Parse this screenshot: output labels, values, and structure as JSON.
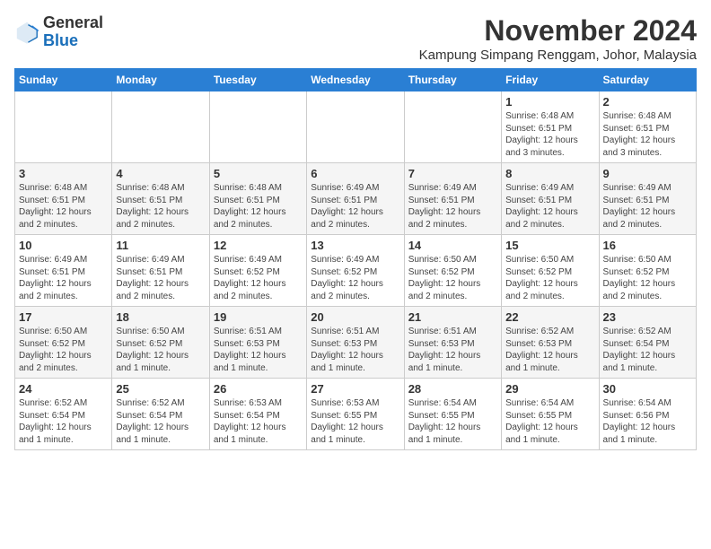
{
  "header": {
    "logo_general": "General",
    "logo_blue": "Blue",
    "month_title": "November 2024",
    "location": "Kampung Simpang Renggam, Johor, Malaysia"
  },
  "weekdays": [
    "Sunday",
    "Monday",
    "Tuesday",
    "Wednesday",
    "Thursday",
    "Friday",
    "Saturday"
  ],
  "weeks": [
    [
      {
        "day": "",
        "info": ""
      },
      {
        "day": "",
        "info": ""
      },
      {
        "day": "",
        "info": ""
      },
      {
        "day": "",
        "info": ""
      },
      {
        "day": "",
        "info": ""
      },
      {
        "day": "1",
        "info": "Sunrise: 6:48 AM\nSunset: 6:51 PM\nDaylight: 12 hours\nand 3 minutes."
      },
      {
        "day": "2",
        "info": "Sunrise: 6:48 AM\nSunset: 6:51 PM\nDaylight: 12 hours\nand 3 minutes."
      }
    ],
    [
      {
        "day": "3",
        "info": "Sunrise: 6:48 AM\nSunset: 6:51 PM\nDaylight: 12 hours\nand 2 minutes."
      },
      {
        "day": "4",
        "info": "Sunrise: 6:48 AM\nSunset: 6:51 PM\nDaylight: 12 hours\nand 2 minutes."
      },
      {
        "day": "5",
        "info": "Sunrise: 6:48 AM\nSunset: 6:51 PM\nDaylight: 12 hours\nand 2 minutes."
      },
      {
        "day": "6",
        "info": "Sunrise: 6:49 AM\nSunset: 6:51 PM\nDaylight: 12 hours\nand 2 minutes."
      },
      {
        "day": "7",
        "info": "Sunrise: 6:49 AM\nSunset: 6:51 PM\nDaylight: 12 hours\nand 2 minutes."
      },
      {
        "day": "8",
        "info": "Sunrise: 6:49 AM\nSunset: 6:51 PM\nDaylight: 12 hours\nand 2 minutes."
      },
      {
        "day": "9",
        "info": "Sunrise: 6:49 AM\nSunset: 6:51 PM\nDaylight: 12 hours\nand 2 minutes."
      }
    ],
    [
      {
        "day": "10",
        "info": "Sunrise: 6:49 AM\nSunset: 6:51 PM\nDaylight: 12 hours\nand 2 minutes."
      },
      {
        "day": "11",
        "info": "Sunrise: 6:49 AM\nSunset: 6:51 PM\nDaylight: 12 hours\nand 2 minutes."
      },
      {
        "day": "12",
        "info": "Sunrise: 6:49 AM\nSunset: 6:52 PM\nDaylight: 12 hours\nand 2 minutes."
      },
      {
        "day": "13",
        "info": "Sunrise: 6:49 AM\nSunset: 6:52 PM\nDaylight: 12 hours\nand 2 minutes."
      },
      {
        "day": "14",
        "info": "Sunrise: 6:50 AM\nSunset: 6:52 PM\nDaylight: 12 hours\nand 2 minutes."
      },
      {
        "day": "15",
        "info": "Sunrise: 6:50 AM\nSunset: 6:52 PM\nDaylight: 12 hours\nand 2 minutes."
      },
      {
        "day": "16",
        "info": "Sunrise: 6:50 AM\nSunset: 6:52 PM\nDaylight: 12 hours\nand 2 minutes."
      }
    ],
    [
      {
        "day": "17",
        "info": "Sunrise: 6:50 AM\nSunset: 6:52 PM\nDaylight: 12 hours\nand 2 minutes."
      },
      {
        "day": "18",
        "info": "Sunrise: 6:50 AM\nSunset: 6:52 PM\nDaylight: 12 hours\nand 1 minute."
      },
      {
        "day": "19",
        "info": "Sunrise: 6:51 AM\nSunset: 6:53 PM\nDaylight: 12 hours\nand 1 minute."
      },
      {
        "day": "20",
        "info": "Sunrise: 6:51 AM\nSunset: 6:53 PM\nDaylight: 12 hours\nand 1 minute."
      },
      {
        "day": "21",
        "info": "Sunrise: 6:51 AM\nSunset: 6:53 PM\nDaylight: 12 hours\nand 1 minute."
      },
      {
        "day": "22",
        "info": "Sunrise: 6:52 AM\nSunset: 6:53 PM\nDaylight: 12 hours\nand 1 minute."
      },
      {
        "day": "23",
        "info": "Sunrise: 6:52 AM\nSunset: 6:54 PM\nDaylight: 12 hours\nand 1 minute."
      }
    ],
    [
      {
        "day": "24",
        "info": "Sunrise: 6:52 AM\nSunset: 6:54 PM\nDaylight: 12 hours\nand 1 minute."
      },
      {
        "day": "25",
        "info": "Sunrise: 6:52 AM\nSunset: 6:54 PM\nDaylight: 12 hours\nand 1 minute."
      },
      {
        "day": "26",
        "info": "Sunrise: 6:53 AM\nSunset: 6:54 PM\nDaylight: 12 hours\nand 1 minute."
      },
      {
        "day": "27",
        "info": "Sunrise: 6:53 AM\nSunset: 6:55 PM\nDaylight: 12 hours\nand 1 minute."
      },
      {
        "day": "28",
        "info": "Sunrise: 6:54 AM\nSunset: 6:55 PM\nDaylight: 12 hours\nand 1 minute."
      },
      {
        "day": "29",
        "info": "Sunrise: 6:54 AM\nSunset: 6:55 PM\nDaylight: 12 hours\nand 1 minute."
      },
      {
        "day": "30",
        "info": "Sunrise: 6:54 AM\nSunset: 6:56 PM\nDaylight: 12 hours\nand 1 minute."
      }
    ]
  ]
}
